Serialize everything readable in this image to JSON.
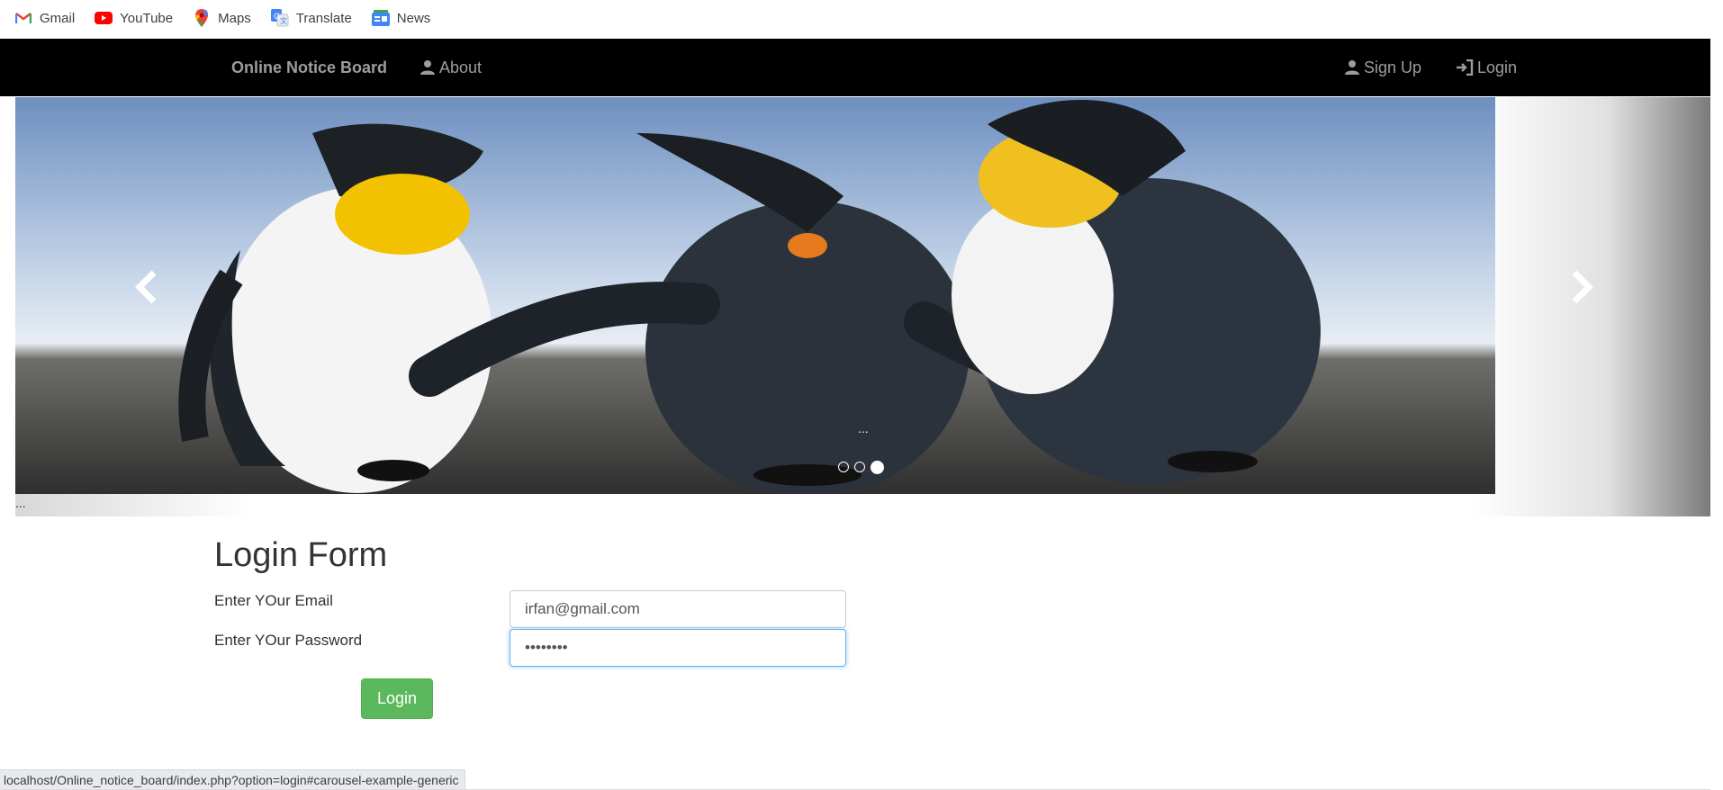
{
  "bookmarks": [
    {
      "label": "Gmail",
      "icon": "gmail-icon"
    },
    {
      "label": "YouTube",
      "icon": "youtube-icon"
    },
    {
      "label": "Maps",
      "icon": "maps-icon"
    },
    {
      "label": "Translate",
      "icon": "translate-icon"
    },
    {
      "label": "News",
      "icon": "news-icon"
    }
  ],
  "navbar": {
    "brand": "Online Notice Board",
    "about": "About",
    "signup": "Sign Up",
    "login": "Login",
    "background": "#000000",
    "link_color": "#9d9d9d"
  },
  "carousel": {
    "caption": "...",
    "outer_caption": "...",
    "indicator_count": 3,
    "active_indicator": 3,
    "prev_icon": "chevron-left-icon",
    "next_icon": "chevron-right-icon"
  },
  "login_form": {
    "title": "Login Form",
    "email_label": "Enter YOur Email",
    "email_value": "irfan@gmail.com",
    "password_label": "Enter YOur Password",
    "password_value": "••••••••",
    "submit_label": "Login",
    "submit_color": "#5cb85c"
  },
  "status_bar": {
    "url": "localhost/Online_notice_board/index.php?option=login#carousel-example-generic"
  }
}
